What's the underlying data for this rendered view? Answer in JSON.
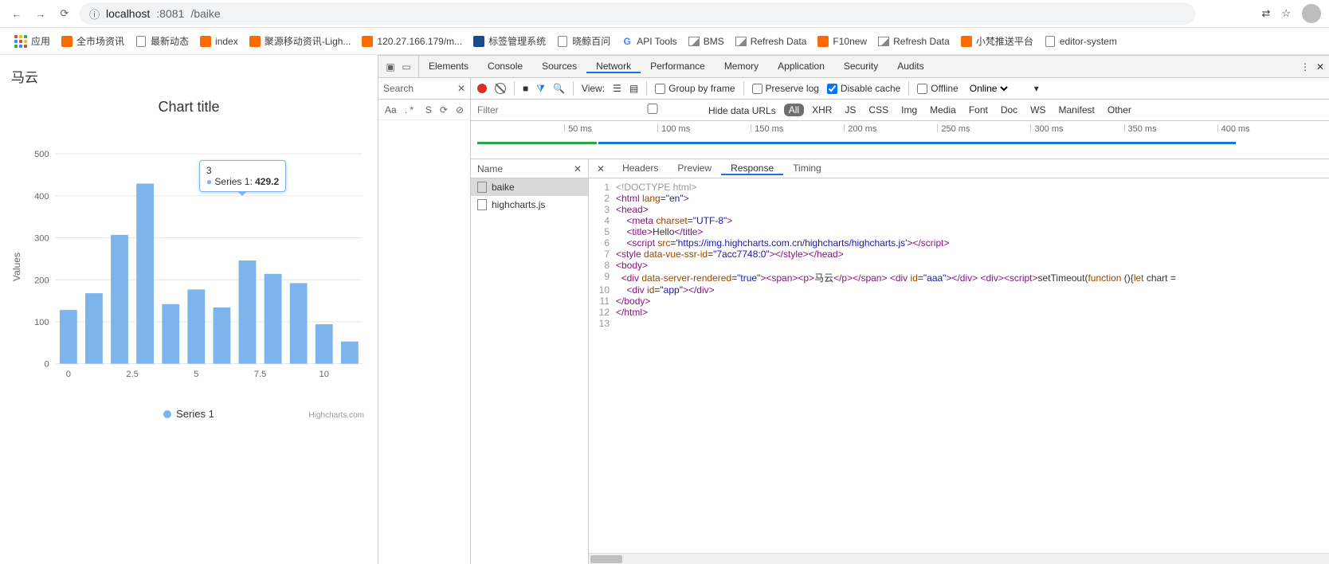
{
  "browser": {
    "url_host": "localhost",
    "url_port": ":8081",
    "url_path": "/baike"
  },
  "bookmarks": {
    "apps": "应用",
    "items": [
      {
        "label": "全市场资讯",
        "icon": "orange"
      },
      {
        "label": "最新动态",
        "icon": "doc"
      },
      {
        "label": "index",
        "icon": "orange"
      },
      {
        "label": "聚源移动资讯-Ligh...",
        "icon": "orange"
      },
      {
        "label": "120.27.166.179/m...",
        "icon": "orange"
      },
      {
        "label": "标签管理系统",
        "icon": "blue"
      },
      {
        "label": "晓鲸百问",
        "icon": "doc"
      },
      {
        "label": "API Tools",
        "icon": "g"
      },
      {
        "label": "BMS",
        "icon": "img"
      },
      {
        "label": "Refresh Data",
        "icon": "img"
      },
      {
        "label": "F10new",
        "icon": "orange"
      },
      {
        "label": "Refresh Data",
        "icon": "img"
      },
      {
        "label": "小梵推送平台",
        "icon": "orange"
      },
      {
        "label": "editor-system",
        "icon": "doc"
      }
    ]
  },
  "page": {
    "heading": "马云"
  },
  "chart_data": {
    "type": "bar",
    "title": "Chart title",
    "xlabel": "",
    "ylabel": "Values",
    "x_ticks": [
      "0",
      "2.5",
      "5",
      "7.5",
      "10"
    ],
    "y_ticks": [
      0,
      100,
      200,
      300,
      400,
      500
    ],
    "ylim": [
      0,
      500
    ],
    "categories": [
      0,
      1,
      2,
      3,
      4,
      5,
      6,
      7,
      8,
      9,
      10,
      11
    ],
    "series": [
      {
        "name": "Series 1",
        "values": [
          128,
          168,
          307,
          429.2,
          142,
          177,
          134,
          246,
          214,
          192,
          94,
          53
        ]
      }
    ],
    "tooltip": {
      "x": "3",
      "series": "Series 1",
      "value": "429.2"
    },
    "credit": "Highcharts.com"
  },
  "devtools": {
    "tabs": [
      "Elements",
      "Console",
      "Sources",
      "Network",
      "Performance",
      "Memory",
      "Application",
      "Security",
      "Audits"
    ],
    "active_tab": "Network",
    "search_panel": {
      "title": "Search",
      "opts": [
        "Aa",
        ". *",
        "S"
      ]
    },
    "net_toolbar": {
      "view": "View:",
      "group": "Group by frame",
      "preserve": "Preserve log",
      "disable": "Disable cache",
      "offline": "Offline",
      "online": "Online"
    },
    "filter": {
      "placeholder": "Filter",
      "hide": "Hide data URLs",
      "types": [
        "All",
        "XHR",
        "JS",
        "CSS",
        "Img",
        "Media",
        "Font",
        "Doc",
        "WS",
        "Manifest",
        "Other"
      ],
      "active_type": "All"
    },
    "timeline_ticks": [
      "50 ms",
      "100 ms",
      "150 ms",
      "200 ms",
      "250 ms",
      "300 ms",
      "350 ms",
      "400 ms"
    ],
    "request_list": {
      "header": "Name",
      "items": [
        "baike",
        "highcharts.js"
      ],
      "selected": "baike"
    },
    "detail": {
      "tabs": [
        "Headers",
        "Preview",
        "Response",
        "Timing"
      ],
      "active": "Response",
      "code": [
        {
          "n": 1,
          "html": "<span class='t-comment'>&lt;!DOCTYPE html&gt;</span>"
        },
        {
          "n": 2,
          "html": "<span class='t-tag'>&lt;html</span> <span class='t-attr'>lang</span>=<span class='t-str'>\"en\"</span><span class='t-tag'>&gt;</span>"
        },
        {
          "n": 3,
          "html": "<span class='t-tag'>&lt;head&gt;</span>"
        },
        {
          "n": 4,
          "html": "    <span class='t-tag'>&lt;meta</span> <span class='t-attr'>charset</span>=<span class='t-str'>\"UTF-8\"</span><span class='t-tag'>&gt;</span>"
        },
        {
          "n": 5,
          "html": "    <span class='t-tag'>&lt;title&gt;</span><span class='t-text'>Hello</span><span class='t-tag'>&lt;/title&gt;</span>"
        },
        {
          "n": 6,
          "html": "    <span class='t-tag'>&lt;script</span> <span class='t-attr'>src</span>=<span class='t-str'>'https://img.highcharts.com.cn/highcharts/highcharts.js'</span><span class='t-tag'>&gt;&lt;/script&gt;</span>"
        },
        {
          "n": 7,
          "html": "<span class='t-tag'>&lt;style</span> <span class='t-attr'>data-vue-ssr-id</span>=<span class='t-str'>\"7acc7748:0\"</span><span class='t-tag'>&gt;&lt;/style&gt;&lt;/head&gt;</span>"
        },
        {
          "n": 8,
          "html": "<span class='t-tag'>&lt;body&gt;</span>"
        },
        {
          "n": 9,
          "html": "  <span class='t-tag'>&lt;div</span> <span class='t-attr'>data-server-rendered</span>=<span class='t-str'>\"true\"</span><span class='t-tag'>&gt;&lt;span&gt;&lt;p&gt;</span><span class='t-text'>马云</span><span class='t-tag'>&lt;/p&gt;&lt;/span&gt;</span> <span class='t-tag'>&lt;div</span> <span class='t-attr'>id</span>=<span class='t-str'>\"aaa\"</span><span class='t-tag'>&gt;&lt;/div&gt;</span> <span class='t-tag'>&lt;div&gt;&lt;script&gt;</span><span class='t-text'>setTimeout(</span><span class='t-attr'>function</span><span class='t-text'> (){</span><span class='t-attr'>let</span><span class='t-text'> chart = </span>"
        },
        {
          "n": 10,
          "html": "    <span class='t-tag'>&lt;div</span> <span class='t-attr'>id</span>=<span class='t-str'>\"app\"</span><span class='t-tag'>&gt;&lt;/div&gt;</span>"
        },
        {
          "n": 11,
          "html": "<span class='t-tag'>&lt;/body&gt;</span>"
        },
        {
          "n": 12,
          "html": "<span class='t-tag'>&lt;/html&gt;</span>"
        },
        {
          "n": 13,
          "html": ""
        }
      ]
    }
  }
}
